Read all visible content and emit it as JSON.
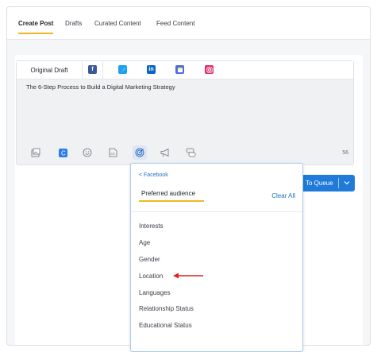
{
  "top_tabs": [
    {
      "label": "Create Post",
      "active": true
    },
    {
      "label": "Drafts",
      "active": false
    },
    {
      "label": "Curated Content",
      "active": false
    },
    {
      "label": "Feed Content",
      "active": false
    }
  ],
  "editor": {
    "original_tab": "Original Draft",
    "social_tabs": [
      {
        "icon": "facebook-icon",
        "glyph": "f",
        "color": "#3b5998"
      },
      {
        "icon": "twitter-icon",
        "glyph": "t",
        "color": "#1da1f2"
      },
      {
        "icon": "linkedin-icon",
        "glyph": "in",
        "color": "#0a66c2"
      },
      {
        "icon": "google-my-business-icon",
        "glyph": "",
        "color": "#4a6fe3"
      },
      {
        "icon": "instagram-icon",
        "glyph": "",
        "color": "#e1306c"
      }
    ],
    "post_text": "The 6-Step Process to Build a Digital Marketing Strategy",
    "char_count": "56",
    "toolbar_icons": [
      "image-icon",
      "canva-icon",
      "emoji-icon",
      "gif-icon",
      "targeting-icon",
      "megaphone-icon",
      "hashtag-icon"
    ]
  },
  "queue_button": {
    "label": "To Queue"
  },
  "audience_dropdown": {
    "back_label": "< Facebook",
    "title": "Preferred audience",
    "clear_all": "Clear All",
    "options": [
      "Interests",
      "Age",
      "Gender",
      "Location",
      "Languages",
      "Relationship Status",
      "Educational Status"
    ]
  },
  "colors": {
    "accent": "#f2b824",
    "primary": "#1f7ad9",
    "annotation_arrow": "#e02020"
  }
}
